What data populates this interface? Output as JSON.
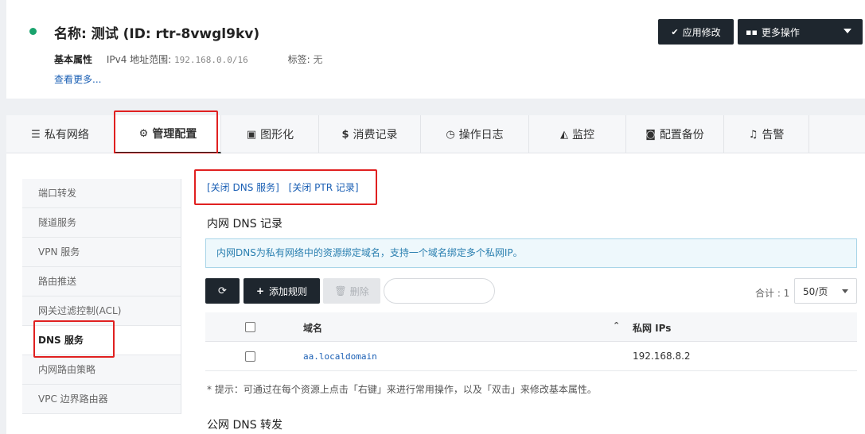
{
  "header": {
    "title": "名称: 测试 (ID: rtr-8vwgl9kv)",
    "basic_props_label": "基本属性",
    "ipv4_label": "IPv4 地址范围:",
    "ipv4_value": "192.168.0.0/16",
    "tag_label": "标签:",
    "tag_value": "无",
    "more_link": "查看更多...",
    "apply_button": "应用修改",
    "more_actions_button": "更多操作",
    "status_color": "#1aa36d"
  },
  "tabs": [
    {
      "label": "私有网络",
      "icon": "list-icon"
    },
    {
      "label": "管理配置",
      "icon": "gears-icon"
    },
    {
      "label": "图形化",
      "icon": "image-icon"
    },
    {
      "label": "消费记录",
      "icon": "dollar-icon"
    },
    {
      "label": "操作日志",
      "icon": "clock-icon"
    },
    {
      "label": "监控",
      "icon": "area-chart-icon"
    },
    {
      "label": "配置备份",
      "icon": "camera-icon"
    },
    {
      "label": "告警",
      "icon": "bell-icon"
    }
  ],
  "active_tab": "管理配置",
  "sidebar": {
    "items": [
      {
        "label": "端口转发"
      },
      {
        "label": "隧道服务"
      },
      {
        "label": "VPN 服务"
      },
      {
        "label": "路由推送"
      },
      {
        "label": "网关过滤控制(ACL)"
      },
      {
        "label": "DNS 服务"
      },
      {
        "label": "内网路由策略"
      },
      {
        "label": "VPC 边界路由器"
      }
    ],
    "active": "DNS 服务"
  },
  "main": {
    "close_dns_link": "[关闭 DNS 服务]",
    "close_ptr_link": "[关闭 PTR 记录]",
    "section_title": "内网 DNS 记录",
    "info_text": "内网DNS为私有网络中的资源绑定域名，支持一个域名绑定多个私网IP。",
    "toolbar": {
      "add_label": "添加规则",
      "delete_label": "删除",
      "search_placeholder": "",
      "total_label": "合计 : 1",
      "page_size": "50/页"
    },
    "table": {
      "columns": [
        "域名",
        "私网 IPs"
      ],
      "rows": [
        {
          "domain": "aa.localdomain",
          "ips": "192.168.8.2"
        }
      ]
    },
    "tip": "* 提示：可通过在每个资源上点击「右键」来进行常用操作，以及「双击」来修改基本属性。",
    "section2_title": "公网 DNS 转发"
  }
}
